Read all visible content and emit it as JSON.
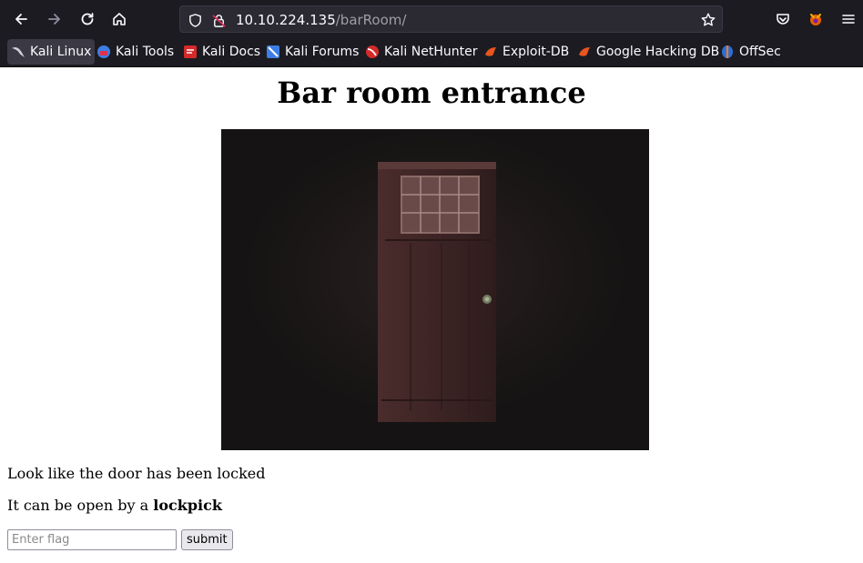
{
  "browser": {
    "url_host": "10.10.224.135",
    "url_path": "/barRoom/"
  },
  "bookmarks": [
    {
      "label": "Kali Linux",
      "icon": "kali-dragon-icon"
    },
    {
      "label": "Kali Tools",
      "icon": "kali-tools-icon"
    },
    {
      "label": "Kali Docs",
      "icon": "kali-docs-icon"
    },
    {
      "label": "Kali Forums",
      "icon": "kali-forums-icon"
    },
    {
      "label": "Kali NetHunter",
      "icon": "kali-nethunter-icon"
    },
    {
      "label": "Exploit-DB",
      "icon": "exploit-db-icon"
    },
    {
      "label": "Google Hacking DB",
      "icon": "ghdb-icon"
    },
    {
      "label": "OffSec",
      "icon": "offsec-icon"
    }
  ],
  "page": {
    "title": "Bar room entrance",
    "message1": "Look like the door has been locked",
    "message2_prefix": "It can be open by a ",
    "message2_bold": "lockpick",
    "flag_placeholder": "Enter flag",
    "submit_label": "submit"
  },
  "colors": {
    "chrome_bg": "#1c1b22",
    "urlbar_bg": "#2b2a33",
    "door": "#3b2323"
  }
}
